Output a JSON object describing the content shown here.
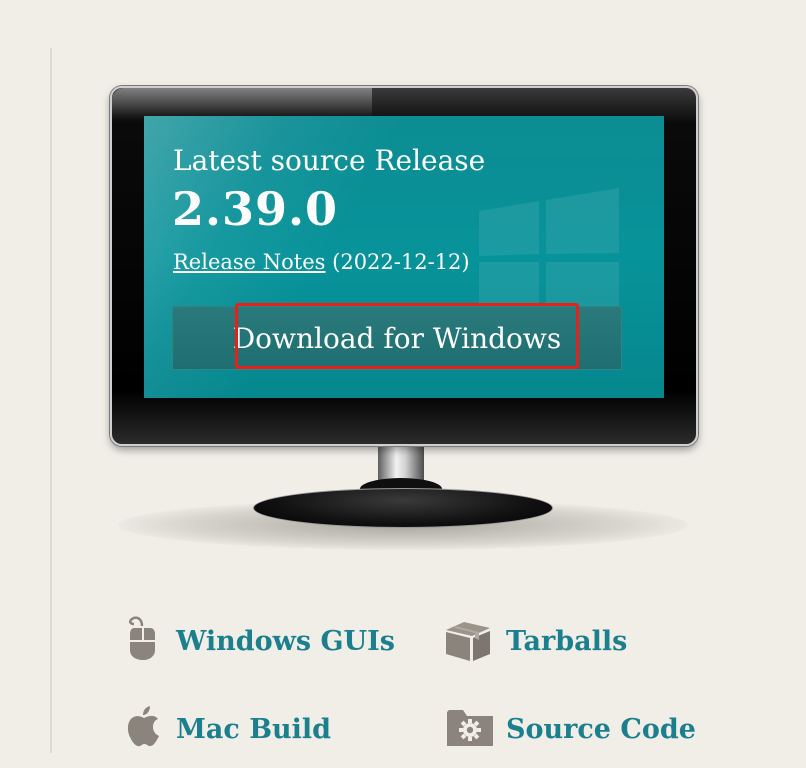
{
  "release": {
    "label": "Latest source Release",
    "version": "2.39.0",
    "notes_link": "Release Notes",
    "date": "(2022-12-12)"
  },
  "download": {
    "label": "Download for Windows"
  },
  "links": {
    "windows_guis": "Windows GUIs",
    "tarballs": "Tarballs",
    "mac_build": "Mac Build",
    "source_code": "Source Code"
  },
  "icons": {
    "mouse": "mouse-icon",
    "box": "box-icon",
    "apple": "apple-icon",
    "gear_folder": "gear-folder-icon"
  },
  "colors": {
    "screen": "#07939a",
    "link": "#1b7f8e",
    "highlight": "#e8201a",
    "icon": "#8a847c",
    "background": "#f0eee7"
  }
}
